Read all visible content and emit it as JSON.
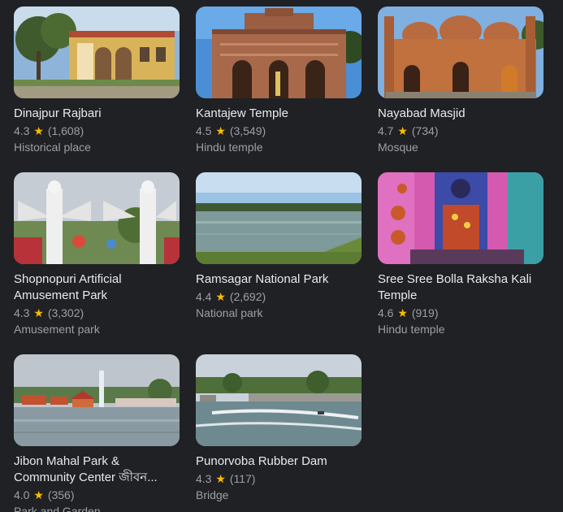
{
  "places": [
    {
      "name": "Dinajpur Rajbari",
      "rating": "4.3",
      "reviews": "(1,608)",
      "category": "Historical place",
      "image": "palace-photo"
    },
    {
      "name": "Kantajew Temple",
      "rating": "4.5",
      "reviews": "(3,549)",
      "category": "Hindu temple",
      "image": "terracotta-temple-photo"
    },
    {
      "name": "Nayabad Masjid",
      "rating": "4.7",
      "reviews": "(734)",
      "category": "Mosque",
      "image": "mosque-photo"
    },
    {
      "name": "Shopnopuri Artificial Amusement Park",
      "rating": "4.3",
      "reviews": "(3,302)",
      "category": "Amusement park",
      "image": "angel-statues-photo"
    },
    {
      "name": "Ramsagar National Park",
      "rating": "4.4",
      "reviews": "(2,692)",
      "category": "National park",
      "image": "lake-photo"
    },
    {
      "name": "Sree Sree Bolla Raksha Kali Temple",
      "rating": "4.6",
      "reviews": "(919)",
      "category": "Hindu temple",
      "image": "kali-idol-photo"
    },
    {
      "name": "Jibon Mahal Park & Community Center জীবন...",
      "rating": "4.0",
      "reviews": "(356)",
      "category": "Park and Garden",
      "image": "fountain-park-photo"
    },
    {
      "name": "Punorvoba Rubber Dam",
      "rating": "4.3",
      "reviews": "(117)",
      "category": "Bridge",
      "image": "river-dam-photo"
    }
  ],
  "star_glyph": "★",
  "colors": {
    "background": "#202124",
    "title": "#e8eaed",
    "secondary": "#9aa0a6",
    "star": "#fbbc04"
  }
}
